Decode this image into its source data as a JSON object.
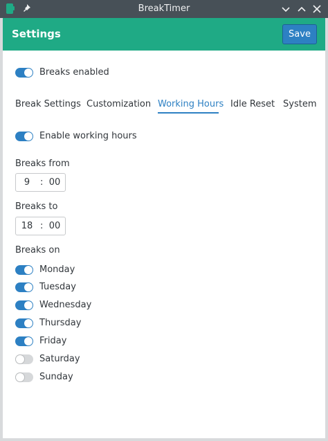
{
  "window": {
    "title": "BreakTimer"
  },
  "header": {
    "title": "Settings",
    "save_label": "Save"
  },
  "breaks_enabled": {
    "label": "Breaks enabled",
    "on": true
  },
  "tabs": [
    {
      "label": "Break Settings",
      "active": false
    },
    {
      "label": "Customization",
      "active": false
    },
    {
      "label": "Working Hours",
      "active": true
    },
    {
      "label": "Idle Reset",
      "active": false
    },
    {
      "label": "System",
      "active": false
    }
  ],
  "working_hours": {
    "enable_label": "Enable working hours",
    "enabled": true,
    "from": {
      "label": "Breaks from",
      "hour": "9",
      "minute": "00"
    },
    "to": {
      "label": "Breaks to",
      "hour": "18",
      "minute": "00"
    },
    "breaks_on_label": "Breaks on",
    "days": [
      {
        "label": "Monday",
        "on": true
      },
      {
        "label": "Tuesday",
        "on": true
      },
      {
        "label": "Wednesday",
        "on": true
      },
      {
        "label": "Thursday",
        "on": true
      },
      {
        "label": "Friday",
        "on": true
      },
      {
        "label": "Saturday",
        "on": false
      },
      {
        "label": "Sunday",
        "on": false
      }
    ]
  },
  "colors": {
    "accent": "#2d80c3",
    "header": "#1faa85",
    "titlebar": "#475057"
  }
}
